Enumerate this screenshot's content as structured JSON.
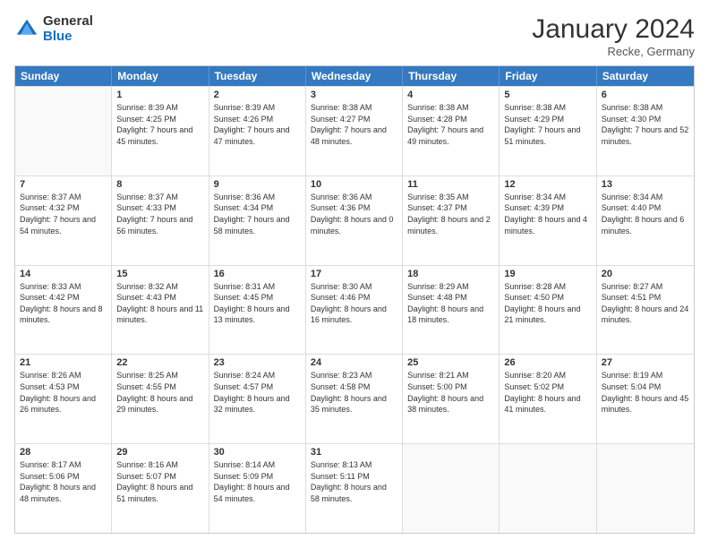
{
  "logo": {
    "general": "General",
    "blue": "Blue"
  },
  "title": "January 2024",
  "subtitle": "Recke, Germany",
  "days": [
    "Sunday",
    "Monday",
    "Tuesday",
    "Wednesday",
    "Thursday",
    "Friday",
    "Saturday"
  ],
  "weeks": [
    [
      {
        "day": "",
        "sunrise": "",
        "sunset": "",
        "daylight": ""
      },
      {
        "day": "1",
        "sunrise": "Sunrise: 8:39 AM",
        "sunset": "Sunset: 4:25 PM",
        "daylight": "Daylight: 7 hours and 45 minutes."
      },
      {
        "day": "2",
        "sunrise": "Sunrise: 8:39 AM",
        "sunset": "Sunset: 4:26 PM",
        "daylight": "Daylight: 7 hours and 47 minutes."
      },
      {
        "day": "3",
        "sunrise": "Sunrise: 8:38 AM",
        "sunset": "Sunset: 4:27 PM",
        "daylight": "Daylight: 7 hours and 48 minutes."
      },
      {
        "day": "4",
        "sunrise": "Sunrise: 8:38 AM",
        "sunset": "Sunset: 4:28 PM",
        "daylight": "Daylight: 7 hours and 49 minutes."
      },
      {
        "day": "5",
        "sunrise": "Sunrise: 8:38 AM",
        "sunset": "Sunset: 4:29 PM",
        "daylight": "Daylight: 7 hours and 51 minutes."
      },
      {
        "day": "6",
        "sunrise": "Sunrise: 8:38 AM",
        "sunset": "Sunset: 4:30 PM",
        "daylight": "Daylight: 7 hours and 52 minutes."
      }
    ],
    [
      {
        "day": "7",
        "sunrise": "Sunrise: 8:37 AM",
        "sunset": "Sunset: 4:32 PM",
        "daylight": "Daylight: 7 hours and 54 minutes."
      },
      {
        "day": "8",
        "sunrise": "Sunrise: 8:37 AM",
        "sunset": "Sunset: 4:33 PM",
        "daylight": "Daylight: 7 hours and 56 minutes."
      },
      {
        "day": "9",
        "sunrise": "Sunrise: 8:36 AM",
        "sunset": "Sunset: 4:34 PM",
        "daylight": "Daylight: 7 hours and 58 minutes."
      },
      {
        "day": "10",
        "sunrise": "Sunrise: 8:36 AM",
        "sunset": "Sunset: 4:36 PM",
        "daylight": "Daylight: 8 hours and 0 minutes."
      },
      {
        "day": "11",
        "sunrise": "Sunrise: 8:35 AM",
        "sunset": "Sunset: 4:37 PM",
        "daylight": "Daylight: 8 hours and 2 minutes."
      },
      {
        "day": "12",
        "sunrise": "Sunrise: 8:34 AM",
        "sunset": "Sunset: 4:39 PM",
        "daylight": "Daylight: 8 hours and 4 minutes."
      },
      {
        "day": "13",
        "sunrise": "Sunrise: 8:34 AM",
        "sunset": "Sunset: 4:40 PM",
        "daylight": "Daylight: 8 hours and 6 minutes."
      }
    ],
    [
      {
        "day": "14",
        "sunrise": "Sunrise: 8:33 AM",
        "sunset": "Sunset: 4:42 PM",
        "daylight": "Daylight: 8 hours and 8 minutes."
      },
      {
        "day": "15",
        "sunrise": "Sunrise: 8:32 AM",
        "sunset": "Sunset: 4:43 PM",
        "daylight": "Daylight: 8 hours and 11 minutes."
      },
      {
        "day": "16",
        "sunrise": "Sunrise: 8:31 AM",
        "sunset": "Sunset: 4:45 PM",
        "daylight": "Daylight: 8 hours and 13 minutes."
      },
      {
        "day": "17",
        "sunrise": "Sunrise: 8:30 AM",
        "sunset": "Sunset: 4:46 PM",
        "daylight": "Daylight: 8 hours and 16 minutes."
      },
      {
        "day": "18",
        "sunrise": "Sunrise: 8:29 AM",
        "sunset": "Sunset: 4:48 PM",
        "daylight": "Daylight: 8 hours and 18 minutes."
      },
      {
        "day": "19",
        "sunrise": "Sunrise: 8:28 AM",
        "sunset": "Sunset: 4:50 PM",
        "daylight": "Daylight: 8 hours and 21 minutes."
      },
      {
        "day": "20",
        "sunrise": "Sunrise: 8:27 AM",
        "sunset": "Sunset: 4:51 PM",
        "daylight": "Daylight: 8 hours and 24 minutes."
      }
    ],
    [
      {
        "day": "21",
        "sunrise": "Sunrise: 8:26 AM",
        "sunset": "Sunset: 4:53 PM",
        "daylight": "Daylight: 8 hours and 26 minutes."
      },
      {
        "day": "22",
        "sunrise": "Sunrise: 8:25 AM",
        "sunset": "Sunset: 4:55 PM",
        "daylight": "Daylight: 8 hours and 29 minutes."
      },
      {
        "day": "23",
        "sunrise": "Sunrise: 8:24 AM",
        "sunset": "Sunset: 4:57 PM",
        "daylight": "Daylight: 8 hours and 32 minutes."
      },
      {
        "day": "24",
        "sunrise": "Sunrise: 8:23 AM",
        "sunset": "Sunset: 4:58 PM",
        "daylight": "Daylight: 8 hours and 35 minutes."
      },
      {
        "day": "25",
        "sunrise": "Sunrise: 8:21 AM",
        "sunset": "Sunset: 5:00 PM",
        "daylight": "Daylight: 8 hours and 38 minutes."
      },
      {
        "day": "26",
        "sunrise": "Sunrise: 8:20 AM",
        "sunset": "Sunset: 5:02 PM",
        "daylight": "Daylight: 8 hours and 41 minutes."
      },
      {
        "day": "27",
        "sunrise": "Sunrise: 8:19 AM",
        "sunset": "Sunset: 5:04 PM",
        "daylight": "Daylight: 8 hours and 45 minutes."
      }
    ],
    [
      {
        "day": "28",
        "sunrise": "Sunrise: 8:17 AM",
        "sunset": "Sunset: 5:06 PM",
        "daylight": "Daylight: 8 hours and 48 minutes."
      },
      {
        "day": "29",
        "sunrise": "Sunrise: 8:16 AM",
        "sunset": "Sunset: 5:07 PM",
        "daylight": "Daylight: 8 hours and 51 minutes."
      },
      {
        "day": "30",
        "sunrise": "Sunrise: 8:14 AM",
        "sunset": "Sunset: 5:09 PM",
        "daylight": "Daylight: 8 hours and 54 minutes."
      },
      {
        "day": "31",
        "sunrise": "Sunrise: 8:13 AM",
        "sunset": "Sunset: 5:11 PM",
        "daylight": "Daylight: 8 hours and 58 minutes."
      },
      {
        "day": "",
        "sunrise": "",
        "sunset": "",
        "daylight": ""
      },
      {
        "day": "",
        "sunrise": "",
        "sunset": "",
        "daylight": ""
      },
      {
        "day": "",
        "sunrise": "",
        "sunset": "",
        "daylight": ""
      }
    ]
  ]
}
